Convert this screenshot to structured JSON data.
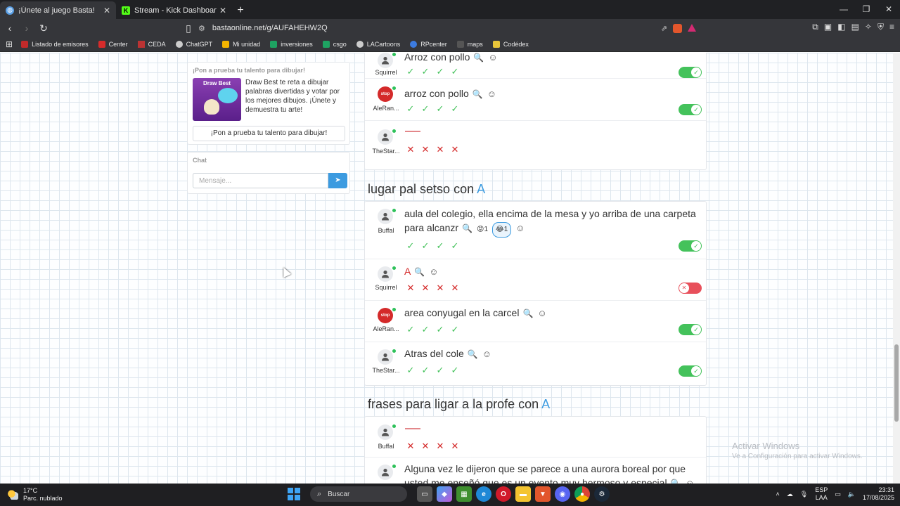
{
  "browser": {
    "tabs": [
      {
        "title": "¡Únete al juego Basta!",
        "active": true
      },
      {
        "title": "Stream - Kick Dashboard",
        "active": false
      }
    ],
    "url": "bastaonline.net/g/AUFAHEHW2Q",
    "bookmarks": [
      "Listado de emisores",
      "Center",
      "CEDA",
      "ChatGPT",
      "Mi unidad",
      "inversiones",
      "csgo",
      "LACartoons",
      "RPcenter",
      "maps",
      "Codédex"
    ]
  },
  "promo": {
    "heading": "¡Pon a prueba tu talento para dibujar!",
    "image_text": "Draw Best",
    "text": "Draw Best te reta a dibujar palabras divertidas y votar por los mejores dibujos. ¡Únete y demuestra tu arte!",
    "button": "¡Pon a prueba tu talento para dibujar!"
  },
  "chat": {
    "title": "Chat",
    "placeholder": "Mensaje..."
  },
  "categories": [
    {
      "title": "",
      "letter": "",
      "rows": [
        {
          "user": "Squirrel",
          "answer": "Arroz con pollo",
          "valid": true,
          "votes": [
            "ok",
            "ok",
            "ok",
            "ok"
          ]
        },
        {
          "user": "AleRan...",
          "answer": "arroz con pollo",
          "valid": true,
          "votes": [
            "ok",
            "ok",
            "ok",
            "ok"
          ],
          "stop": true
        },
        {
          "user": "TheStar...",
          "answer": "",
          "valid": null,
          "votes": [
            "no",
            "no",
            "no",
            "no"
          ]
        }
      ]
    },
    {
      "title": "lugar pal setso con",
      "letter": "A",
      "rows": [
        {
          "user": "Buffal",
          "answer": "aula del colegio, ella encima de la mesa y yo arriba de una carpeta para alcanzr",
          "valid": true,
          "votes": [
            "ok",
            "ok",
            "ok",
            "ok"
          ],
          "reactions": [
            {
              "emoji": "😡",
              "count": "1"
            },
            {
              "emoji": "😂",
              "count": "1"
            }
          ]
        },
        {
          "user": "Squirrel",
          "answer": "A",
          "valid": false,
          "votes": [
            "no",
            "no",
            "no",
            "no"
          ]
        },
        {
          "user": "AleRan...",
          "answer": "area conyugal en la carcel",
          "valid": true,
          "votes": [
            "ok",
            "ok",
            "ok",
            "ok"
          ],
          "stop": true
        },
        {
          "user": "TheStar...",
          "answer": "Atras del cole",
          "valid": true,
          "votes": [
            "ok",
            "ok",
            "ok",
            "ok"
          ]
        }
      ]
    },
    {
      "title": "frases para ligar a la profe con",
      "letter": "A",
      "rows": [
        {
          "user": "Buffal",
          "answer": "",
          "valid": null,
          "votes": [
            "no",
            "no",
            "no",
            "no"
          ]
        },
        {
          "user": "",
          "answer": "Alguna vez le dijeron que se parece a una aurora boreal por que usted me enseñó que es un evento muy hermoso y especial",
          "valid": null,
          "votes": []
        }
      ]
    }
  ],
  "icons": {
    "check": "✓",
    "cross": "✕",
    "search": "🔍",
    "emoji_add": "☺",
    "stop_badge": "stop"
  },
  "watermark": {
    "line1": "Activar Windows",
    "line2": "Ve a Configuración para activar Windows."
  },
  "taskbar": {
    "weather_temp": "17°C",
    "weather_desc": "Parc. nublado",
    "search_label": "Buscar",
    "lang1": "ESP",
    "lang2": "LAA",
    "time": "23:31",
    "date": "17/08/2025"
  },
  "colors": {
    "accent": "#3c9be0",
    "valid": "#44c25b",
    "invalid": "#d42a2a"
  }
}
